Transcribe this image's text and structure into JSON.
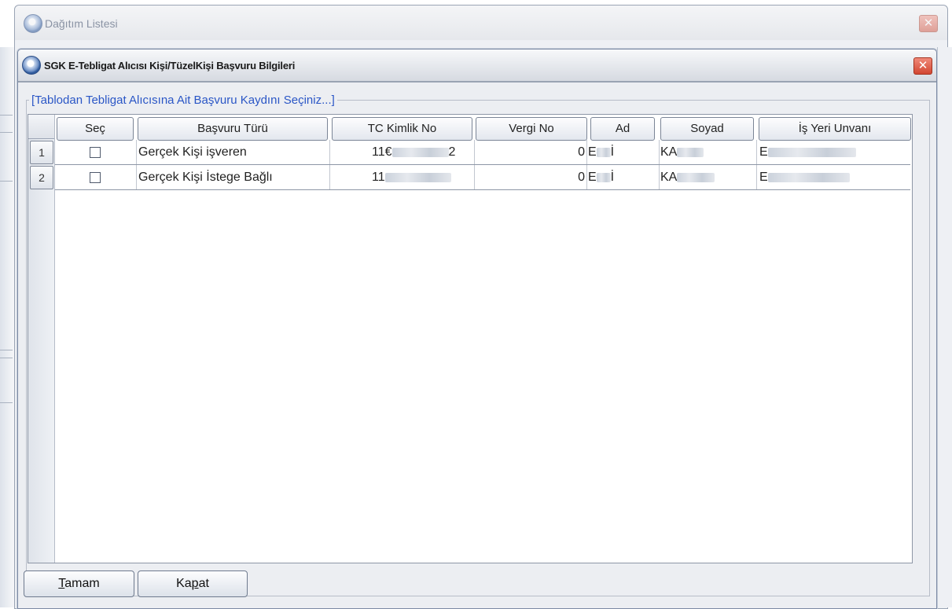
{
  "background_window": {
    "title": "Dağıtım Listesi",
    "close_label": "✕"
  },
  "dialog": {
    "title": "SGK E-Tebligat Alıcısı Kişi/TüzelKişi Başvuru Bilgileri",
    "close_label": "✕",
    "group_label": "[Tablodan Tebligat Alıcısına Ait Başvuru Kaydını Seçiniz...]",
    "columns": [
      "Seç",
      "Başvuru Türü",
      "TC Kimlik No",
      "Vergi No",
      "Ad",
      "Soyad",
      "İş Yeri Unvanı"
    ],
    "rows": [
      {
        "num": "1",
        "checked": false,
        "type": "Gerçek Kişi işveren",
        "tc_prefix": "11€",
        "tc_suffix": "2",
        "vergi": "0",
        "ad_prefix": "E",
        "ad_suffix": "İ",
        "soyad_prefix": "KA",
        "unvan_prefix": "E"
      },
      {
        "num": "2",
        "checked": false,
        "type": "Gerçek Kişi İstege Bağlı",
        "tc_prefix": "11",
        "tc_suffix": "",
        "vergi": "0",
        "ad_prefix": "E",
        "ad_suffix": "İ",
        "soyad_prefix": "KA",
        "unvan_prefix": "E"
      }
    ],
    "buttons": {
      "ok_mnemonic": "T",
      "ok_rest": "amam",
      "close_before": "Ka",
      "close_mnemonic": "p",
      "close_after": "at"
    }
  }
}
